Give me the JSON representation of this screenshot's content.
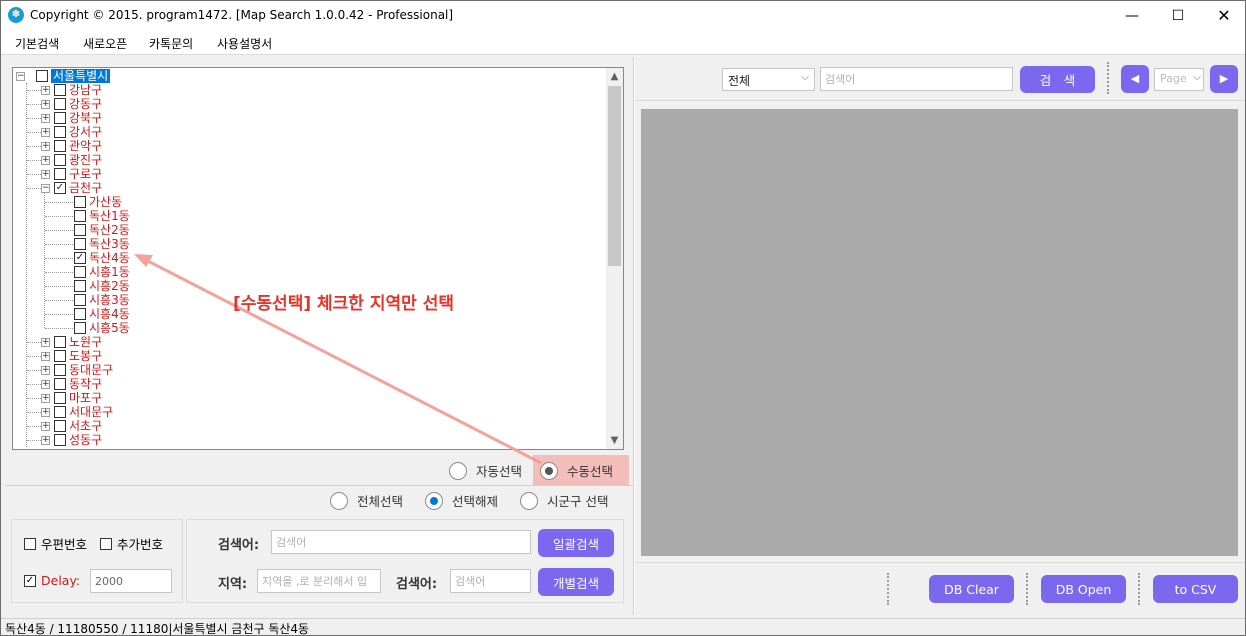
{
  "window": {
    "title": "Copyright © 2015. program1472. [Map Search 1.0.0.42 - Professional]"
  },
  "menu": [
    "기본검색",
    "새로오픈",
    "카톡문의",
    "사용설명서"
  ],
  "tree": {
    "root": "서울특별시",
    "districts_top": [
      "강남구",
      "강동구",
      "강북구",
      "강서구",
      "관악구",
      "광진구",
      "구로구"
    ],
    "expanded": {
      "label": "금천구",
      "children": [
        {
          "label": "가산동",
          "checked": false
        },
        {
          "label": "독산1동",
          "checked": false
        },
        {
          "label": "독산2동",
          "checked": false
        },
        {
          "label": "독산3동",
          "checked": false
        },
        {
          "label": "독산4동",
          "checked": true
        },
        {
          "label": "시흥1동",
          "checked": false
        },
        {
          "label": "시흥2동",
          "checked": false
        },
        {
          "label": "시흥3동",
          "checked": false
        },
        {
          "label": "시흥4동",
          "checked": false
        },
        {
          "label": "시흥5동",
          "checked": false
        }
      ]
    },
    "districts_bottom": [
      "노원구",
      "도봉구",
      "동대문구",
      "동작구",
      "마포구",
      "서대문구",
      "서초구",
      "성동구"
    ]
  },
  "annotation": "[수동선택] 체크한 지역만 선택",
  "selection_mode": {
    "auto": "자동선택",
    "manual": "수동선택",
    "selected": "manual"
  },
  "selection_scope": {
    "all": "전체선택",
    "clear": "선택해제",
    "sigungu": "시군구 선택",
    "selected": "clear"
  },
  "options": {
    "postal_label": "우편번호",
    "extra_label": "추가번호",
    "delay_label": "Delay:",
    "delay_value": "2000"
  },
  "search": {
    "keyword_label": "검색어:",
    "keyword_placeholder": "검색어",
    "bulk_button": "일괄검색",
    "region_label": "지역:",
    "region_placeholder": "지역을 ,로 분리해서 입",
    "keyword2_label": "검색어:",
    "keyword2_placeholder": "검색어",
    "individual_button": "개별검색"
  },
  "right": {
    "filter_value": "전체",
    "search_placeholder": "검색어",
    "search_button": "검　색",
    "page_placeholder": "Page",
    "db_clear": "DB Clear",
    "db_open": "DB Open",
    "to_csv": "to CSV"
  },
  "status": "독산4동 / 11180550 / 11180|서울특별시 금천구 독산4동",
  "colors": {
    "accent": "#7b68ee",
    "tree_text": "#d01818",
    "annotation": "#e8332a",
    "map_bg": "#aaaaaa"
  }
}
